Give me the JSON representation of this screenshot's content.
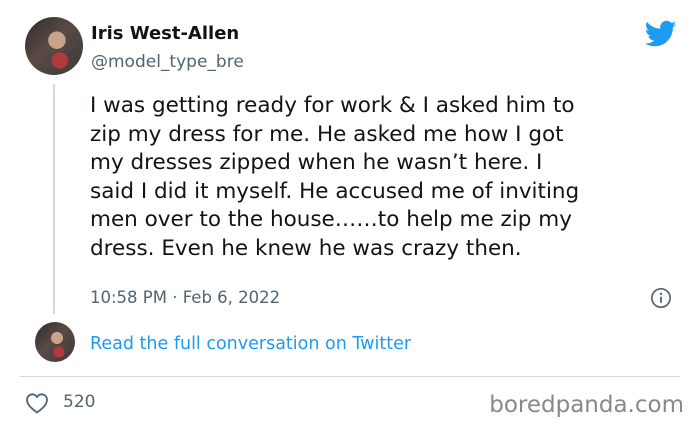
{
  "author": {
    "name": "Iris West-Allen",
    "handle": "@model_type_bre"
  },
  "tweet": {
    "lines": [
      "I was getting ready for work & I asked him to",
      "zip my dress for me. He asked me how I got",
      "my dresses zipped when he wasn’t here. I",
      "said I did it myself. He accused me of inviting",
      "men over to the house……to help me zip my",
      "dress. Even he knew he was crazy then."
    ],
    "timestamp": "10:58 PM · Feb 6, 2022"
  },
  "conversation_link": "Read the full conversation on Twitter",
  "likes": "520",
  "watermark": "boredpanda.com",
  "colors": {
    "twitter_blue": "#1d9bf0",
    "secondary_text": "#536471",
    "primary_text": "#0f1419"
  },
  "icons": {
    "brand": "twitter-bird-icon",
    "info": "info-icon",
    "like": "heart-icon"
  }
}
